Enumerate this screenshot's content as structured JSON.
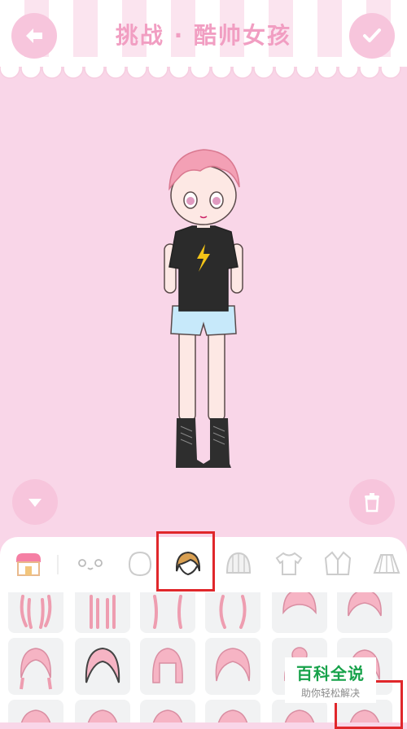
{
  "header": {
    "title": "挑战 · 酷帅女孩"
  },
  "colors": {
    "background": "#f9d6e8",
    "accent": "#f19ec2",
    "button": "#f7c5dc",
    "highlight": "#e0272b"
  },
  "tabs": [
    {
      "icon": "shop-icon"
    },
    {
      "icon": "face-icon"
    },
    {
      "icon": "head-icon"
    },
    {
      "icon": "hair-icon",
      "selected": true
    },
    {
      "icon": "hat-icon"
    },
    {
      "icon": "tshirt-icon"
    },
    {
      "icon": "jacket-icon"
    },
    {
      "icon": "skirt-icon"
    }
  ],
  "watermark": {
    "main": "百科全说",
    "sub": "助你轻松解决"
  }
}
